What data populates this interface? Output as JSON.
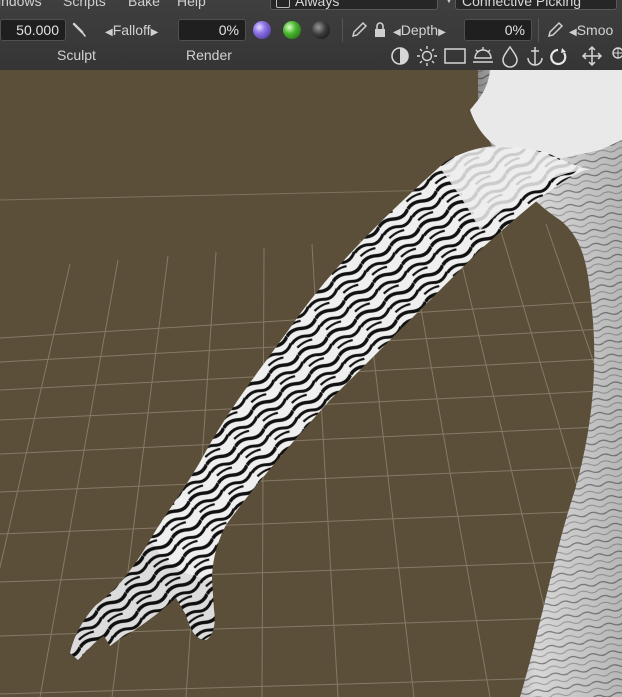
{
  "menu": {
    "windows": "indows",
    "scripts": "Scripts",
    "bake": "Bake",
    "help": "Help"
  },
  "always_dropdown": {
    "value": "Always"
  },
  "picking_dropdown": {
    "value": "Connective Picking"
  },
  "toolbar": {
    "strength_value": "50.000",
    "falloff_label": "Falloff",
    "falloff_value": "0%",
    "depth_label": "Depth",
    "depth_value": "0%",
    "smooth_label": "Smoo",
    "sculpt_label": "Sculpt",
    "render_label": "Render"
  },
  "colors": {
    "toolbar_bg": "#3b3b3b",
    "viewport_bg": "#5b4f39",
    "grid_line": "#8a7f6a",
    "material_purple": "#7d5fd3",
    "material_green": "#45b02c",
    "material_dark": "#2a2a2a"
  },
  "icons": [
    "brush-icon",
    "falloff-prev-icon",
    "falloff-next-icon",
    "material-purple-icon",
    "material-green-icon",
    "material-dark-icon",
    "pencil-icon",
    "lock-icon",
    "depth-prev-icon",
    "depth-next-icon",
    "pencil2-icon",
    "smooth-prev-icon",
    "contrast-icon",
    "sun-icon",
    "rectangle-icon",
    "lamp-icon",
    "drop-icon",
    "anchor-icon",
    "rotate-icon",
    "move-icon",
    "target-icon"
  ]
}
